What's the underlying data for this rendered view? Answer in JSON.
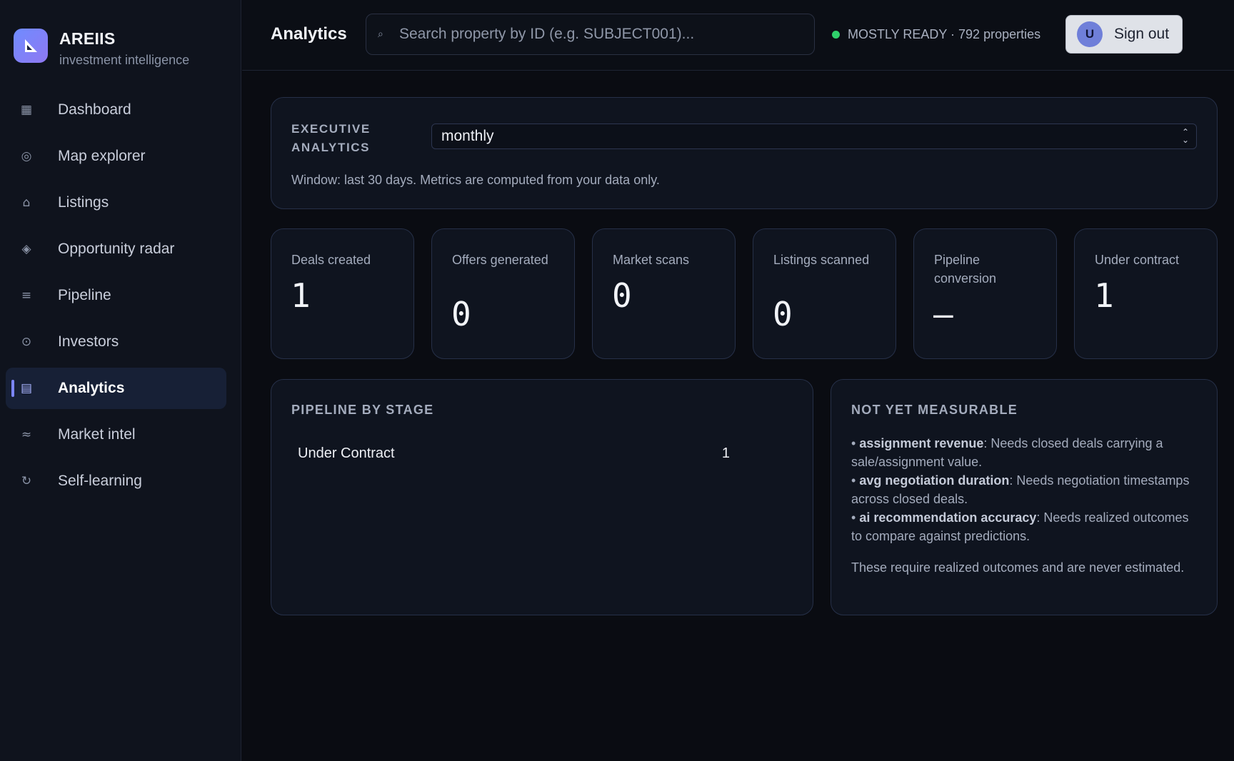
{
  "brand": {
    "name": "AREIIS",
    "tagline": "investment intelligence"
  },
  "sidebar": {
    "items": [
      {
        "label": "Dashboard",
        "icon": "grid-icon",
        "glyph": "▦"
      },
      {
        "label": "Map explorer",
        "icon": "globe-icon",
        "glyph": "◎"
      },
      {
        "label": "Listings",
        "icon": "home-icon",
        "glyph": "⌂"
      },
      {
        "label": "Opportunity radar",
        "icon": "diamond-icon",
        "glyph": "◈"
      },
      {
        "label": "Pipeline",
        "icon": "pipeline-icon",
        "glyph": "≡"
      },
      {
        "label": "Investors",
        "icon": "investors-icon",
        "glyph": "⊙"
      },
      {
        "label": "Analytics",
        "icon": "analytics-icon",
        "glyph": "▤",
        "active": true
      },
      {
        "label": "Market intel",
        "icon": "wave-icon",
        "glyph": "≈"
      },
      {
        "label": "Self-learning",
        "icon": "refresh-icon",
        "glyph": "↻"
      }
    ]
  },
  "header": {
    "title": "Analytics",
    "search_placeholder": "Search property by ID (e.g. SUBJECT001)...",
    "search_icon": "⌕",
    "status_text": "MOSTLY READY · 792 properties",
    "status_color": "#2fd06b",
    "avatar_initial": "U",
    "signout_label": "Sign out"
  },
  "executive": {
    "label": "EXECUTIVE ANALYTICS",
    "period": "monthly",
    "note": "Window: last 30 days. Metrics are computed from your data only."
  },
  "metrics": [
    {
      "label": "Deals created",
      "value": "1"
    },
    {
      "label": "Offers generated",
      "value": "0"
    },
    {
      "label": "Market scans",
      "value": "0"
    },
    {
      "label": "Listings scanned",
      "value": "0"
    },
    {
      "label": "Pipeline conversion",
      "value": "—"
    },
    {
      "label": "Under contract",
      "value": "1"
    }
  ],
  "pipeline": {
    "title": "PIPELINE BY STAGE",
    "stages": [
      {
        "name": "Under Contract",
        "count": "1"
      }
    ]
  },
  "not_measurable": {
    "title": "NOT YET MEASURABLE",
    "items": [
      {
        "name": "assignment revenue",
        "reason": ": Needs closed deals carrying a sale/assignment value."
      },
      {
        "name": "avg negotiation duration",
        "reason": ": Needs negotiation timestamps across closed deals."
      },
      {
        "name": "ai recommendation accuracy",
        "reason": ": Needs realized outcomes to compare against predictions."
      }
    ],
    "footnote": "These require realized outcomes and are never estimated."
  },
  "colors": {
    "accent": "#7c86ff",
    "background": "#0a0c12",
    "panel": "#0f141f"
  }
}
